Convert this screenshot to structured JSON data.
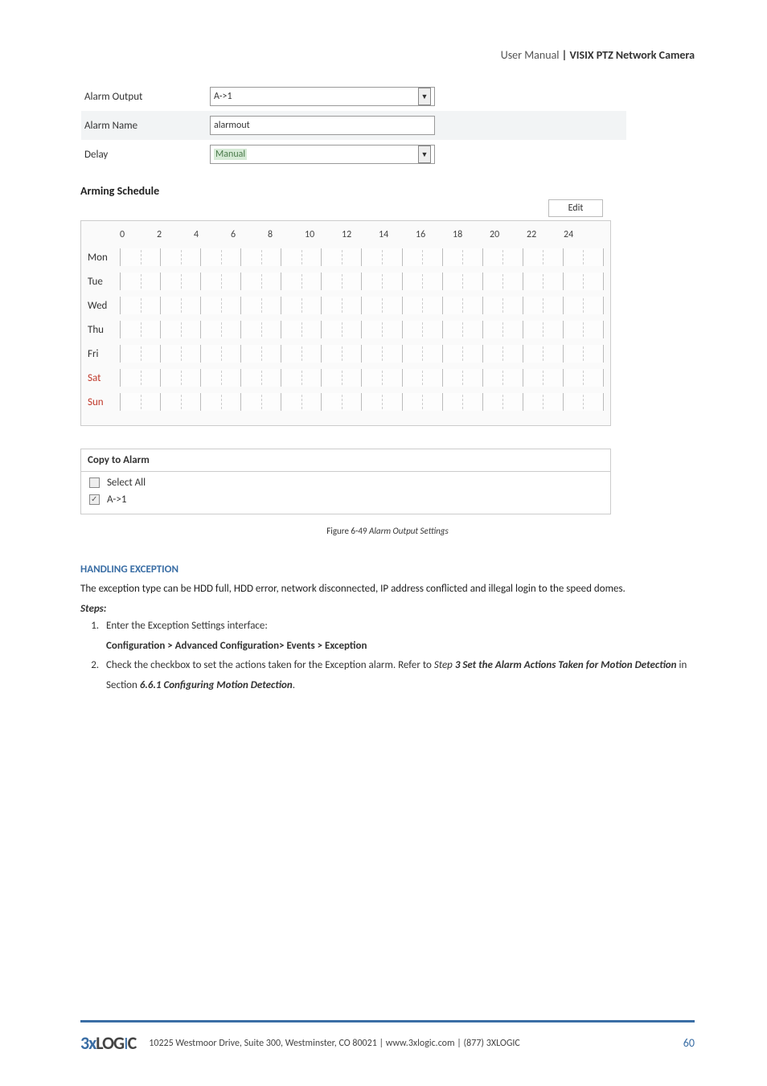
{
  "header": {
    "prefix": "User Manual",
    "title": "| VISIX PTZ Network Camera"
  },
  "form": {
    "alarm_output_label": "Alarm Output",
    "alarm_output_value": "A->1",
    "alarm_name_label": "Alarm Name",
    "alarm_name_value": "alarmout",
    "delay_label": "Delay",
    "delay_value": "Manual"
  },
  "schedule": {
    "title": "Arming Schedule",
    "edit_label": "Edit",
    "hours": [
      "0",
      "2",
      "4",
      "6",
      "8",
      "10",
      "12",
      "14",
      "16",
      "18",
      "20",
      "22",
      "24"
    ],
    "days": [
      {
        "label": "Mon",
        "weekend": false
      },
      {
        "label": "Tue",
        "weekend": false
      },
      {
        "label": "Wed",
        "weekend": false
      },
      {
        "label": "Thu",
        "weekend": false
      },
      {
        "label": "Fri",
        "weekend": false
      },
      {
        "label": "Sat",
        "weekend": true
      },
      {
        "label": "Sun",
        "weekend": true
      }
    ]
  },
  "copy": {
    "title": "Copy to Alarm",
    "select_all": "Select All",
    "item1": "A->1"
  },
  "figure": {
    "prefix": "Figure 6-49",
    "title": "Alarm Output Settings"
  },
  "section": {
    "heading": "HANDLING EXCEPTION",
    "para": "The exception type can be HDD full, HDD error, network disconnected, IP address conflicted and illegal login to the speed domes.",
    "steps_label": "Steps:",
    "step1_a": "Enter the Exception Settings interface:",
    "step1_b": "Configuration > Advanced Configuration> Events > Exception",
    "step2_a": "Check the checkbox to set the actions taken for the Exception alarm. Refer to ",
    "step2_b": "Step",
    "step2_c": "3 Set the Alarm Actions Taken for Motion Detection",
    "step2_d": " in Section ",
    "step2_e": "6.6.1 Configuring Motion Detection",
    "step2_f": "."
  },
  "footer": {
    "logo1": "3x",
    "logo2": "LOG",
    "logo3": "I",
    "logo4": "C",
    "text": "10225 Westmoor Drive, Suite 300, Westminster, CO 80021 | www.3xlogic.com | (877) 3XLOGIC",
    "page": "60"
  }
}
